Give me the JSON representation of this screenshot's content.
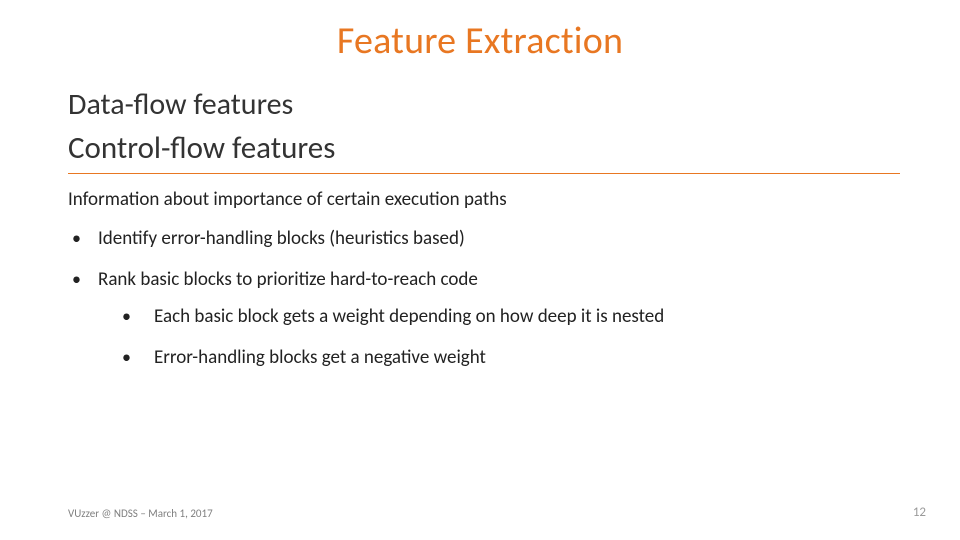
{
  "title": "Feature Extraction",
  "sections": {
    "dataflow": "Data-flow features",
    "controlflow": "Control-flow features"
  },
  "lead": "Information about importance of certain execution paths",
  "bullets_top": [
    "Identify error-handling blocks (heuristics based)",
    "Rank basic blocks to prioritize hard-to-reach code"
  ],
  "bullets_inner": [
    "Each basic block gets a weight depending on how deep it is nested",
    "Error-handling blocks get a negative weight"
  ],
  "footer": {
    "left": "VUzzer @ NDSS – March 1, 2017",
    "page": "12"
  },
  "accent": "#e87722"
}
